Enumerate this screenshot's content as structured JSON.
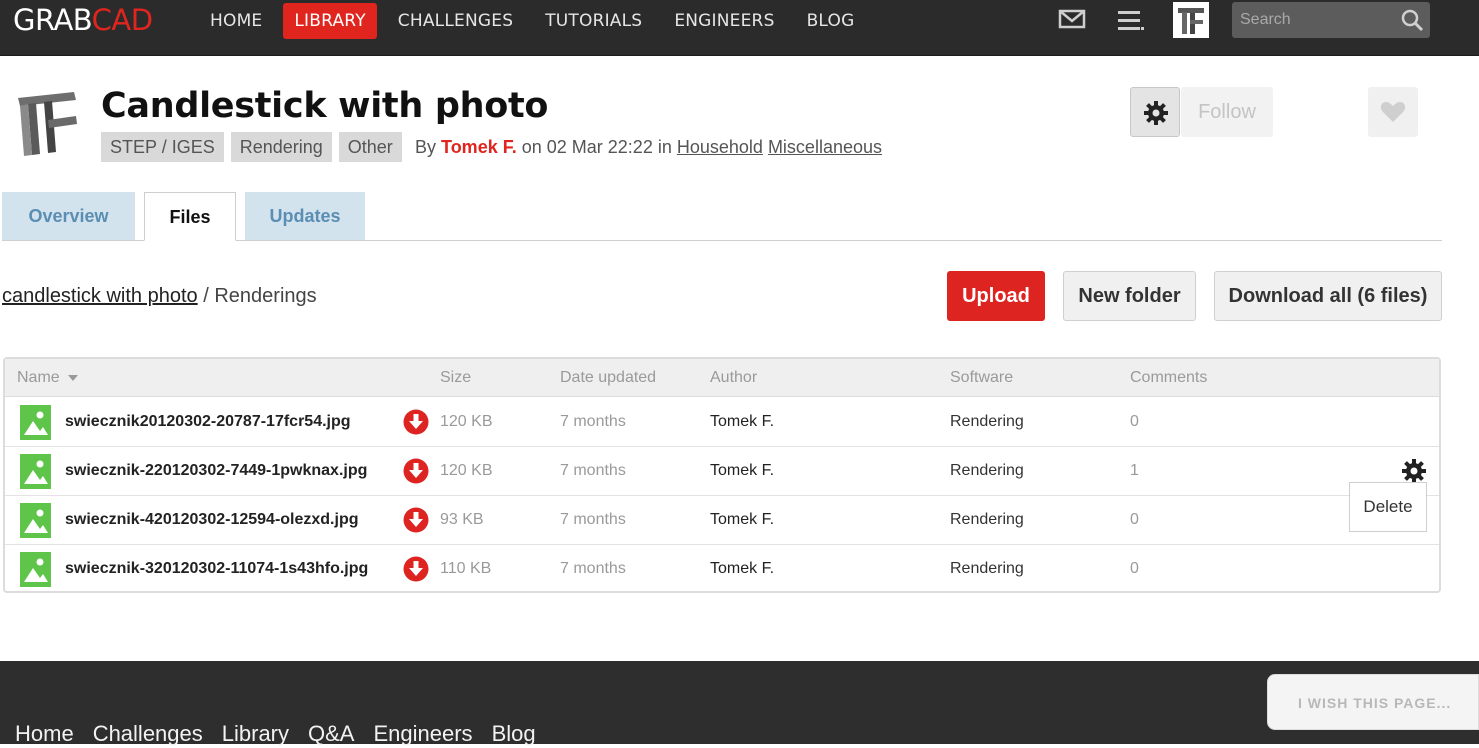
{
  "brand": {
    "part1": "GRAB",
    "part2": "CAD"
  },
  "nav": {
    "items": [
      {
        "label": "HOME",
        "active": false
      },
      {
        "label": "LIBRARY",
        "active": true
      },
      {
        "label": "CHALLENGES",
        "active": false
      },
      {
        "label": "TUTORIALS",
        "active": false
      },
      {
        "label": "ENGINEERS",
        "active": false
      },
      {
        "label": "BLOG",
        "active": false
      }
    ],
    "search_placeholder": "Search"
  },
  "model": {
    "title": "Candlestick with photo",
    "tags": [
      "STEP / IGES",
      "Rendering",
      "Other"
    ],
    "by_label": "By",
    "author": "Tomek F.",
    "date_text": "on 02 Mar 22:22 in",
    "categories": [
      "Household",
      "Miscellaneous"
    ],
    "follow_label": "Follow"
  },
  "tabs": [
    "Overview",
    "Files",
    "Updates"
  ],
  "breadcrumb": {
    "root": "candlestick with photo",
    "separator": "/",
    "current": "Renderings"
  },
  "actions": {
    "upload": "Upload",
    "new_folder": "New folder",
    "download_all": "Download all (6 files)"
  },
  "table": {
    "headers": {
      "name": "Name",
      "size": "Size",
      "date": "Date updated",
      "author": "Author",
      "software": "Software",
      "comments": "Comments"
    },
    "rows": [
      {
        "name": "swiecznik20120302-20787-17fcr54.jpg",
        "size": "120 KB",
        "date": "7 months",
        "author": "Tomek F.",
        "software": "Rendering",
        "comments": "0"
      },
      {
        "name": "swiecznik-220120302-7449-1pwknax.jpg",
        "size": "120 KB",
        "date": "7 months",
        "author": "Tomek F.",
        "software": "Rendering",
        "comments": "1"
      },
      {
        "name": "swiecznik-420120302-12594-olezxd.jpg",
        "size": "93 KB",
        "date": "7 months",
        "author": "Tomek F.",
        "software": "Rendering",
        "comments": "0"
      },
      {
        "name": "swiecznik-320120302-11074-1s43hfo.jpg",
        "size": "110 KB",
        "date": "7 months",
        "author": "Tomek F.",
        "software": "Rendering",
        "comments": "0"
      }
    ],
    "delete_label": "Delete"
  },
  "footer": {
    "links": [
      "Home",
      "Challenges",
      "Library",
      "Q&A",
      "Engineers",
      "Blog"
    ],
    "wish_label": "I WISH THIS PAGE..."
  },
  "colors": {
    "accent": "#e0251f",
    "topbar": "#2b2b2b",
    "tab_inactive_bg": "#d3e3ee",
    "tab_inactive_text": "#5b8eb3",
    "file_icon_green": "#5fc54a"
  }
}
